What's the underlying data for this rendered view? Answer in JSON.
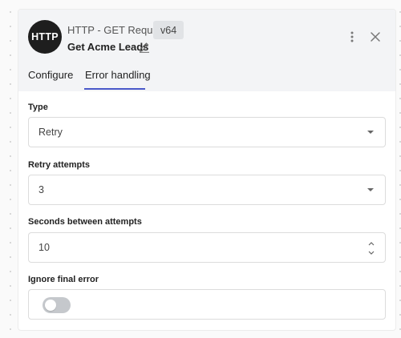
{
  "node": {
    "logo_text": "HTTP",
    "type": "HTTP - GET Request",
    "version": "v64",
    "name": "Get Acme Leads"
  },
  "tabs": [
    {
      "label": "Configure",
      "active": false
    },
    {
      "label": "Error handling",
      "active": true
    }
  ],
  "form": {
    "type": {
      "label": "Type",
      "value": "Retry"
    },
    "retry_attempts": {
      "label": "Retry attempts",
      "value": "3"
    },
    "seconds_between": {
      "label": "Seconds between attempts",
      "value": "10"
    },
    "ignore_final_error": {
      "label": "Ignore final error",
      "enabled": false
    }
  },
  "icons": [
    "edit-icon",
    "more-vertical-icon",
    "close-icon",
    "chevron-down-icon",
    "stepper-icon"
  ],
  "colors": {
    "accent": "#4a58c9",
    "toggle_off": "#c5c8cc",
    "logo_bg": "#1e1e1e"
  }
}
